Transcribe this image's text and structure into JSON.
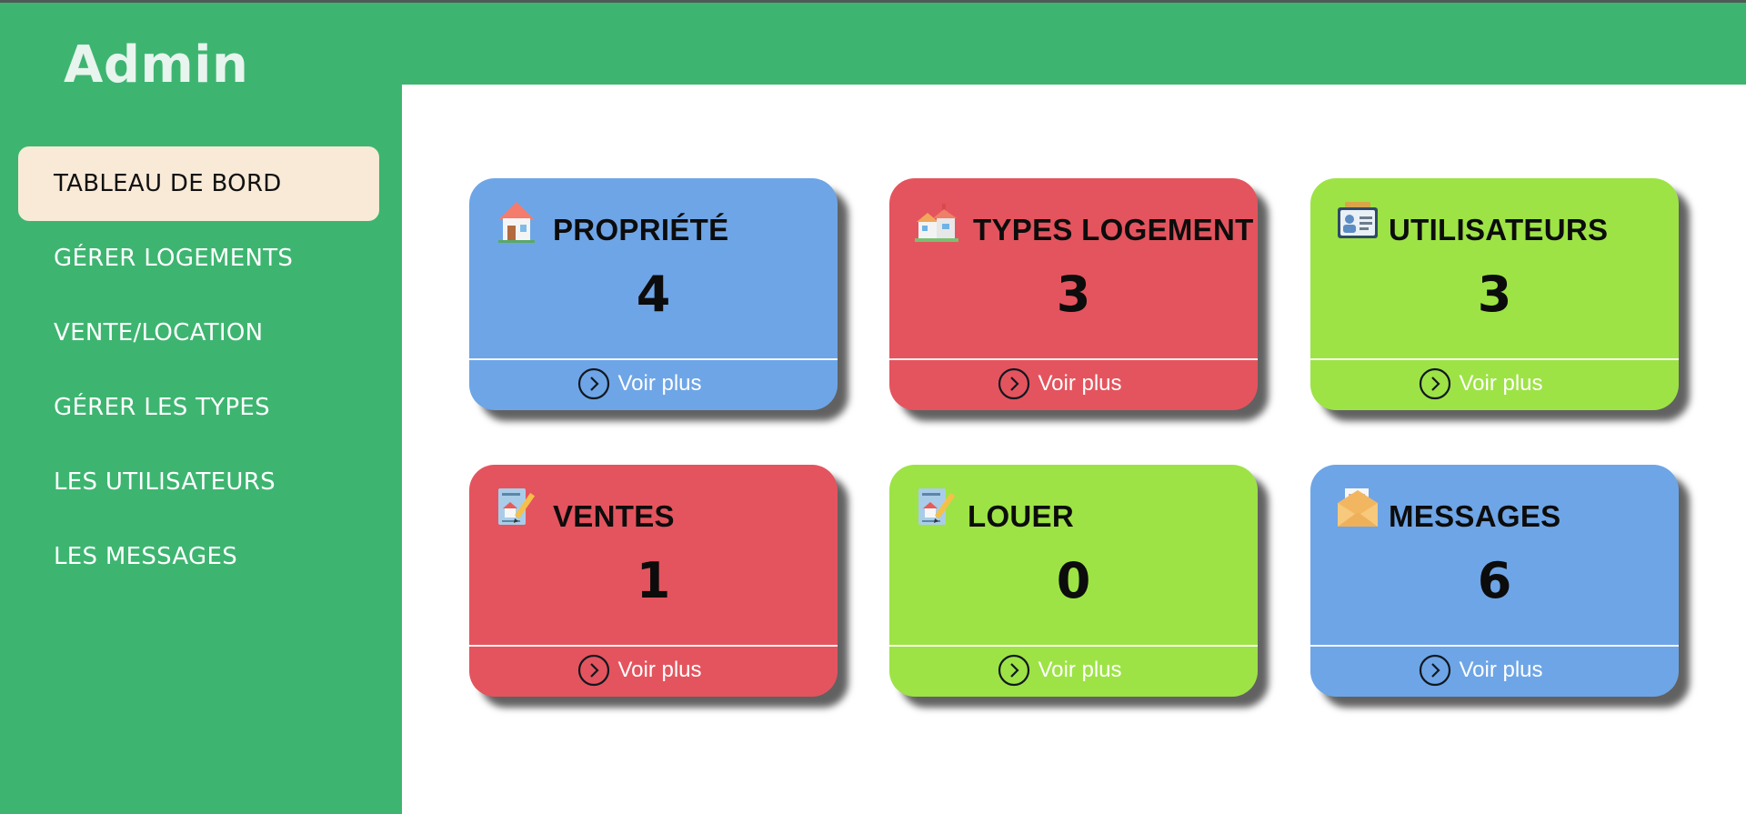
{
  "app": {
    "brand": "Admin"
  },
  "sidebar": {
    "items": [
      {
        "label": "TABLEAU DE BORD",
        "active": true
      },
      {
        "label": "GÉRER LOGEMENTS"
      },
      {
        "label": "VENTE/LOCATION"
      },
      {
        "label": "GÉRER LES TYPES"
      },
      {
        "label": "LES UTILISATEURS"
      },
      {
        "label": "LES MESSAGES"
      }
    ]
  },
  "colors": {
    "green": "#3db570",
    "active_nav_bg": "#f8ead7",
    "blue_card": "#6ea5e6",
    "red_card": "#e4545e",
    "lime_card": "#9de345"
  },
  "cards": [
    {
      "title": "PROPRIÉTÉ",
      "count": "4",
      "link": "Voir plus",
      "icon": "house-icon",
      "color": "#6ea5e6"
    },
    {
      "title": "TYPES LOGEMENT",
      "count": "3",
      "link": "Voir plus",
      "icon": "houses-icon",
      "color": "#e4545e"
    },
    {
      "title": "UTILISATEURS",
      "count": "3",
      "link": "Voir plus",
      "icon": "id-card-icon",
      "color": "#9de345"
    },
    {
      "title": "VENTES",
      "count": "1",
      "link": "Voir plus",
      "icon": "contract-icon",
      "color": "#e4545e"
    },
    {
      "title": "LOUER",
      "count": "0",
      "link": "Voir plus",
      "icon": "contract-icon",
      "color": "#9de345"
    },
    {
      "title": "MESSAGES",
      "count": "6",
      "link": "Voir plus",
      "icon": "envelope-icon",
      "color": "#6ea5e6"
    }
  ]
}
